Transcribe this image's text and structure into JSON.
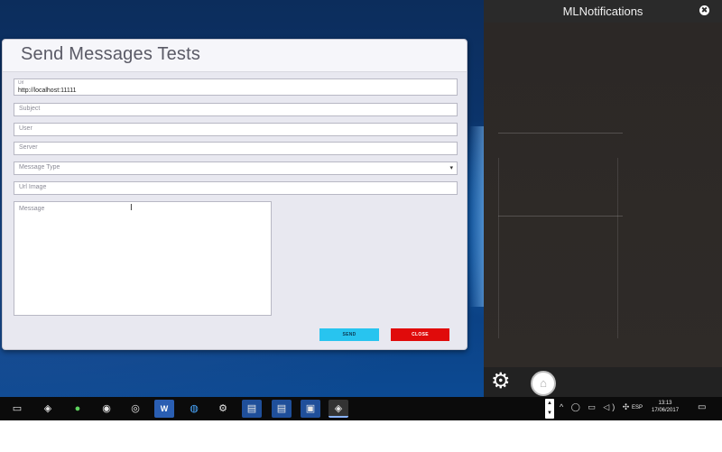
{
  "dialog": {
    "title": "Send Messages Tests",
    "url_label": "Url",
    "url_value": "http://localhost:11111",
    "subject_placeholder": "Subject",
    "user_placeholder": "User",
    "server_placeholder": "Server",
    "message_type_placeholder": "Message Type",
    "url_image_placeholder": "Url Image",
    "message_placeholder": "Message",
    "send_label": "SEND",
    "close_label": "CLOSE"
  },
  "notifications": {
    "title": "MLNotifications",
    "close_glyph": "✖",
    "settings_glyph": "⚙",
    "inbox_glyph": "⌂"
  },
  "taskbar": {
    "language": "ESP",
    "time": "13:13",
    "date": "17/06/2017",
    "tray_glyphs": "^ ◯ ▭ ◁) ✣"
  },
  "colors": {
    "send_button": "#28c4ef",
    "close_button": "#e00b0b",
    "notif_bg": "#2b2826"
  }
}
